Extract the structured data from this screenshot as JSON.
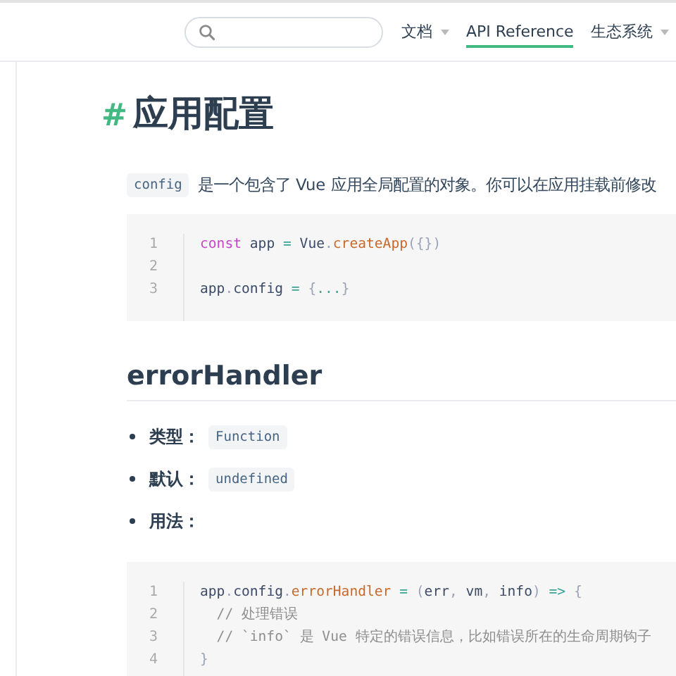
{
  "header": {
    "nav": [
      {
        "label": "文档",
        "selected": false,
        "dropdown": true
      },
      {
        "label": "API Reference",
        "selected": true,
        "dropdown": false
      },
      {
        "label": "生态系统",
        "selected": false,
        "dropdown": true
      }
    ]
  },
  "content": {
    "title_mark": "#",
    "title": "应用配置",
    "intro": {
      "code": "config",
      "text": "是一个包含了 Vue 应用全局配置的对象。你可以在应用挂载前修改"
    },
    "code_block_1": [
      {
        "number": "1",
        "tokens": [
          {
            "kind": "keyword",
            "text": "const"
          },
          {
            "kind": "plain",
            "text": " app "
          },
          {
            "kind": "operator",
            "text": "="
          },
          {
            "kind": "plain",
            "text": " Vue"
          },
          {
            "kind": "punct",
            "text": "."
          },
          {
            "kind": "func",
            "text": "createApp"
          },
          {
            "kind": "punct",
            "text": "({})"
          }
        ]
      },
      {
        "number": "2"
      },
      {
        "number": "3",
        "tokens": [
          {
            "kind": "plain",
            "text": "app"
          },
          {
            "kind": "punct",
            "text": "."
          },
          {
            "kind": "plain",
            "text": "config "
          },
          {
            "kind": "operator",
            "text": "="
          },
          {
            "kind": "punct",
            "text": " {"
          },
          {
            "kind": "operator",
            "text": "..."
          },
          {
            "kind": "punct",
            "text": "}"
          }
        ]
      }
    ],
    "section_title": "errorHandler",
    "properties": [
      {
        "label": "类型：",
        "code": "Function"
      },
      {
        "label": "默认：",
        "code": "undefined"
      },
      {
        "label": "用法："
      }
    ],
    "code_block_2": [
      {
        "number": "1",
        "tokens": [
          {
            "kind": "plain",
            "text": "app"
          },
          {
            "kind": "punct",
            "text": "."
          },
          {
            "kind": "plain",
            "text": "config"
          },
          {
            "kind": "punct",
            "text": "."
          },
          {
            "kind": "func",
            "text": "errorHandler"
          },
          {
            "kind": "operator",
            "text": " = "
          },
          {
            "kind": "punct",
            "text": "("
          },
          {
            "kind": "plain",
            "text": "err"
          },
          {
            "kind": "punct",
            "text": ", "
          },
          {
            "kind": "plain",
            "text": "vm"
          },
          {
            "kind": "punct",
            "text": ", "
          },
          {
            "kind": "plain",
            "text": "info"
          },
          {
            "kind": "punct",
            "text": ") "
          },
          {
            "kind": "operator",
            "text": "=>"
          },
          {
            "kind": "punct",
            "text": " {"
          }
        ]
      },
      {
        "number": "2",
        "tokens": [
          {
            "kind": "comment",
            "text": "  // 处理错误"
          }
        ]
      },
      {
        "number": "3",
        "tokens": [
          {
            "kind": "comment",
            "text": "  // `info` 是 Vue 特定的错误信息，比如错误所在的生命周期钩子"
          }
        ]
      },
      {
        "number": "4",
        "tokens": [
          {
            "kind": "punct",
            "text": "}"
          }
        ]
      }
    ]
  }
}
